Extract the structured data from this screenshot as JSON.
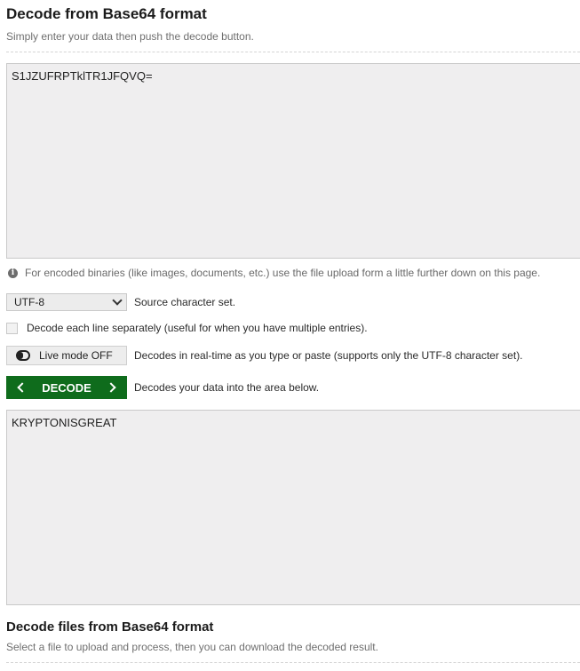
{
  "header": {
    "title": "Decode from Base64 format",
    "subtitle": "Simply enter your data then push the decode button."
  },
  "input": {
    "value": "S1JZUFRPTklTR1JFQVQ="
  },
  "info": {
    "icon": "info-icon",
    "text": "For encoded binaries (like images, documents, etc.) use the file upload form a little further down on this page."
  },
  "charset": {
    "selected": "UTF-8",
    "label": "Source character set."
  },
  "separate_lines": {
    "checked": false,
    "label": "Decode each line separately (useful for when you have multiple entries)."
  },
  "live_mode": {
    "button_label": "Live mode OFF",
    "description": "Decodes in real-time as you type or paste (supports only the UTF-8 character set)."
  },
  "decode": {
    "button_label": "DECODE",
    "description": "Decodes your data into the area below.",
    "color": "#0f6c1c"
  },
  "output": {
    "value": "KRYPTONISGREAT"
  },
  "files_section": {
    "title": "Decode files from Base64 format",
    "subtitle": "Select a file to upload and process, then you can download the decoded result."
  }
}
